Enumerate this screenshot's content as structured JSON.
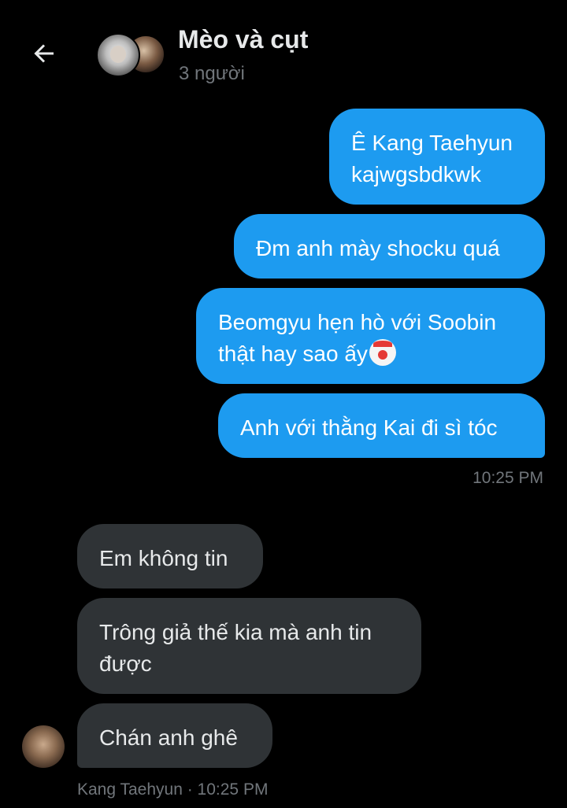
{
  "header": {
    "title": "Mèo và cụt",
    "subtitle": "3 người"
  },
  "messages_out": [
    {
      "text": "Ê Kang Taehyun\nkajwgsbdkwk"
    },
    {
      "text": "Đm anh mày shocku quá"
    },
    {
      "text": "Beomgyu hẹn hò với Soobin\nthật hay sao ấy"
    },
    {
      "text": "Anh với thằng Kai đi sì tóc"
    }
  ],
  "messages_out_time": "10:25 PM",
  "messages_in": [
    {
      "text": "Em không tin"
    },
    {
      "text": "Trông giả thế kia mà anh tin\nđược"
    },
    {
      "text": "Chán anh ghê"
    }
  ],
  "messages_in_meta": "Kang Taehyun · 10:25 PM",
  "icons": {
    "back": "arrow-left-icon",
    "emoji": "clown-face-emoji"
  },
  "colors": {
    "outgoing_bubble": "#1d9bf0",
    "incoming_bubble": "#2f3336",
    "background": "#000000",
    "secondary_text": "#71767b"
  }
}
